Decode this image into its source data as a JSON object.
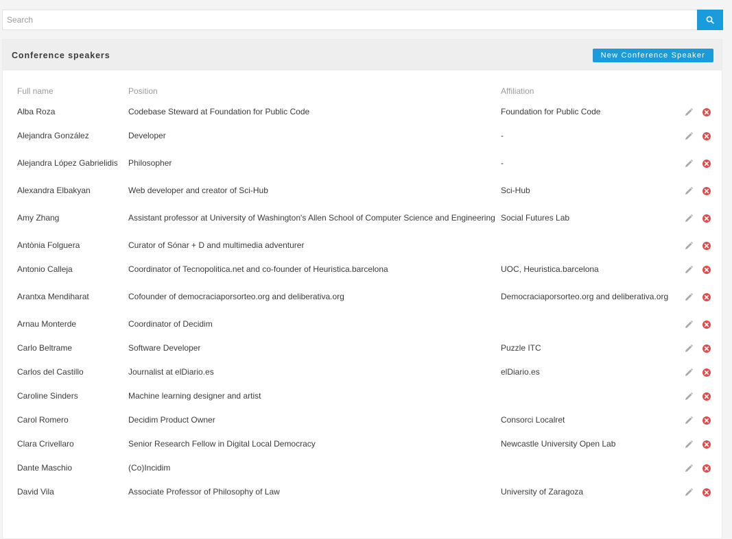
{
  "search": {
    "placeholder": "Search",
    "button_icon": "search-icon"
  },
  "colors": {
    "accent": "#1a9bdb",
    "delete": "#e04c4c",
    "edit": "#a0a0a0"
  },
  "card": {
    "title": "Conference speakers",
    "new_button_label": "New Conference Speaker"
  },
  "table": {
    "headers": {
      "name": "Full name",
      "position": "Position",
      "affiliation": "Affiliation"
    },
    "rows": [
      {
        "name": "Alba Roza",
        "position": "Codebase Steward at Foundation for Public Code",
        "affiliation": "Foundation for Public Code"
      },
      {
        "name": "Alejandra González",
        "position": "Developer",
        "affiliation": "-"
      },
      {
        "name": "Alejandra López Gabrielidis",
        "position": "Philosopher",
        "affiliation": "-"
      },
      {
        "name": "Alexandra Elbakyan",
        "position": "Web developer and creator of Sci-Hub",
        "affiliation": "Sci-Hub"
      },
      {
        "name": "Amy Zhang",
        "position": "Assistant professor at University of Washington's Allen School of Computer Science and Engineering",
        "affiliation": "Social Futures Lab"
      },
      {
        "name": "Antònia Folguera",
        "position": "Curator of Sónar + D and multimedia adventurer",
        "affiliation": ""
      },
      {
        "name": "Antonio Calleja",
        "position": "Coordinator of Tecnopolitica.net and co-founder of Heuristica.barcelona",
        "affiliation": "UOC, Heuristica.barcelona"
      },
      {
        "name": "Arantxa Mendiharat",
        "position": "Cofounder of democraciaporsorteo.org and deliberativa.org",
        "affiliation": "Democraciaporsorteo.org and deliberativa.org"
      },
      {
        "name": "Arnau Monterde",
        "position": "Coordinator of Decidim",
        "affiliation": ""
      },
      {
        "name": "Carlo Beltrame",
        "position": "Software Developer",
        "affiliation": "Puzzle ITC"
      },
      {
        "name": "Carlos del Castillo",
        "position": "Journalist at elDiario.es",
        "affiliation": "elDiario.es"
      },
      {
        "name": "Caroline Sinders",
        "position": "Machine learning designer and artist",
        "affiliation": ""
      },
      {
        "name": "Carol Romero",
        "position": "Decidim Product Owner",
        "affiliation": "Consorci Localret"
      },
      {
        "name": "Clara Crivellaro",
        "position": "Senior Research Fellow in Digital Local Democracy",
        "affiliation": "Newcastle University Open Lab"
      },
      {
        "name": "Dante Maschio",
        "position": "(Co)Incidim",
        "affiliation": ""
      },
      {
        "name": "David Vila",
        "position": "Associate Professor of Philosophy of Law",
        "affiliation": "University of Zaragoza"
      }
    ],
    "row_actions": [
      "pencil-icon",
      "delete-icon"
    ]
  }
}
